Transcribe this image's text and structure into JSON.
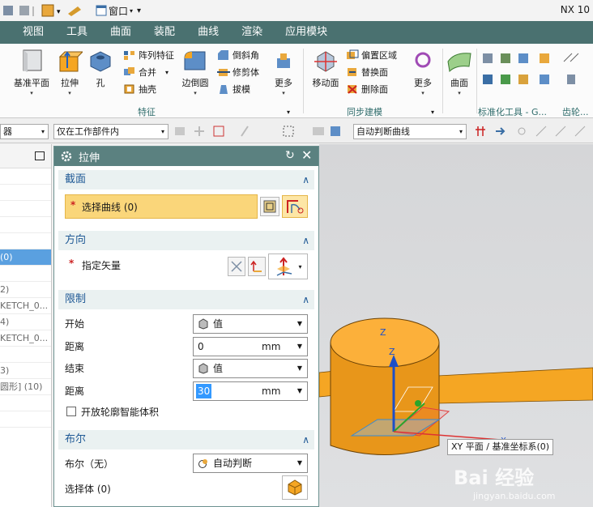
{
  "app_title": "NX 10",
  "quick_access": {
    "window_label": "窗口"
  },
  "menu_tabs": [
    "视图",
    "工具",
    "曲面",
    "装配",
    "曲线",
    "渲染",
    "应用模块"
  ],
  "ribbon": {
    "datum_plane": "基准平面",
    "extrude": "拉伸",
    "hole": "孔",
    "pattern_feature": "阵列特征",
    "unite": "合并",
    "shell": "抽壳",
    "edge_blend": "边倒圆",
    "chamfer": "倒斜角",
    "trim_body": "修剪体",
    "draft": "拔模",
    "more1": "更多",
    "move_face": "移动面",
    "offset_region": "偏置区域",
    "replace_face": "替换面",
    "delete_face": "删除面",
    "more2": "更多",
    "surface": "曲面",
    "group_feature": "特征",
    "group_sync": "同步建模",
    "group_standard": "标准化工具 - G...",
    "group_gear": "齿轮..."
  },
  "toolbar2": {
    "left_combo": "器",
    "scope_combo": "仅在工作部件内",
    "curve_rule_combo": "自动判断曲线"
  },
  "left_pane": {
    "rows": [
      "",
      "",
      "",
      "",
      "",
      "(0)",
      "",
      "2)",
      "KETCH_0...",
      "4)",
      "KETCH_0...",
      "",
      "3)",
      "圆形] (10)",
      "",
      ""
    ]
  },
  "dialog": {
    "title": "拉伸",
    "section": {
      "header": "截面",
      "select_curve": "选择曲线 (0)"
    },
    "direction": {
      "header": "方向",
      "specify_vector": "指定矢量"
    },
    "limits": {
      "header": "限制",
      "start_label": "开始",
      "start_option": "值",
      "distance1_label": "距离",
      "distance1_value": "0",
      "unit": "mm",
      "end_label": "结束",
      "end_option": "值",
      "distance2_label": "距离",
      "distance2_value": "30",
      "open_profile_label": "开放轮廓智能体积"
    },
    "boolean": {
      "header": "布尔",
      "boolean_label": "布尔（无）",
      "boolean_option": "自动判断",
      "select_body": "选择体 (0)"
    }
  },
  "viewport": {
    "tooltip": "XY 平面 / 基准坐标系(0)",
    "axis_z1": "Z",
    "axis_z2": "Z",
    "axis_x": "X",
    "watermark": "Bai 经验",
    "watermark_url": "jingyan.baidu.com"
  },
  "colors": {
    "menubar": "#4a7170",
    "dialog_title": "#5b8180",
    "section_header_text": "#205a96",
    "required_field_bg": "#fad67a",
    "solid_orange": "#f5a623"
  }
}
